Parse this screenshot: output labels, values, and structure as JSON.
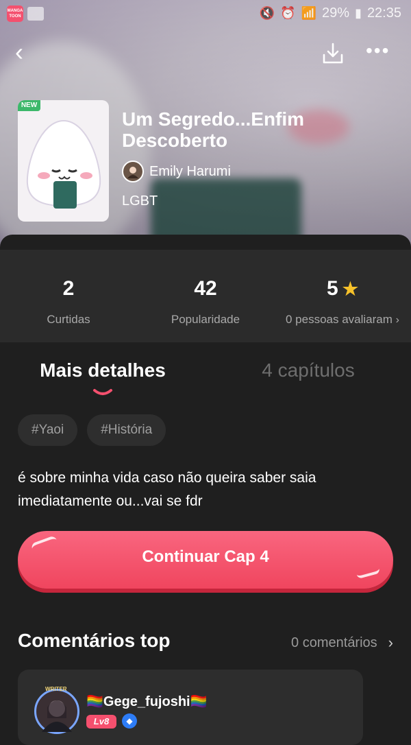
{
  "status_bar": {
    "app_badge": "MANGA TOON",
    "battery": "29%",
    "time": "22:35"
  },
  "header": {
    "back_icon": "back-arrow-icon",
    "download_icon": "download-icon",
    "more_icon": "more-dots-icon"
  },
  "comic": {
    "new_tag": "NEW",
    "title": "Um Segredo...Enfim Descoberto",
    "author": "Emily Harumi",
    "genre": "LGBT"
  },
  "stats": {
    "likes": {
      "value": "2",
      "label": "Curtidas"
    },
    "popularity": {
      "value": "42",
      "label": "Popularidade"
    },
    "rating": {
      "value": "5",
      "label": "0 pessoas avaliaram"
    }
  },
  "tabs": [
    {
      "label": "Mais detalhes",
      "active": true
    },
    {
      "label": "4 capítulos",
      "active": false
    }
  ],
  "hashtags": [
    "#Yaoi",
    "#História"
  ],
  "description": "é sobre minha vida caso não queira saber saia imediatamente ou...vai se fdr",
  "cta": {
    "label": "Continuar Cap 4"
  },
  "comments": {
    "title": "Comentários top",
    "count": "0 comentários",
    "top": {
      "badge": "WRITER",
      "username": "🏳️‍🌈Gege_fujoshi🏳️‍🌈",
      "level": "Lv8"
    }
  },
  "colors": {
    "accent": "#f4506e",
    "star": "#f6c12a",
    "new_tag": "#3cb86a",
    "verified": "#2d7cf6"
  }
}
